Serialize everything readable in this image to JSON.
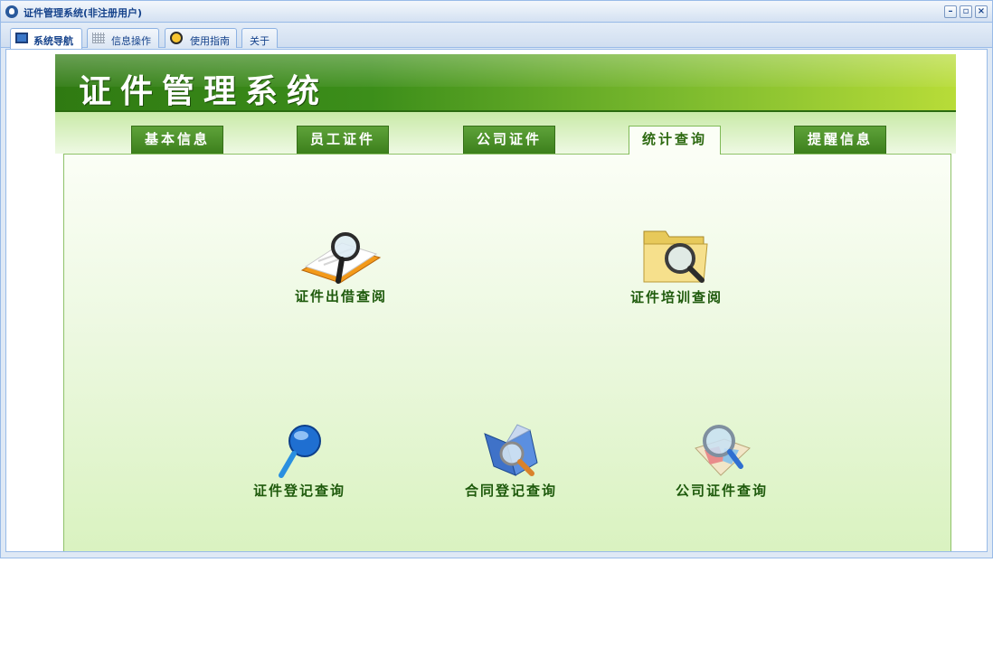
{
  "window": {
    "title": "证件管理系统(非注册用户)"
  },
  "app_tabs": [
    {
      "label": "系统导航",
      "icon": "monitor-icon",
      "active": true
    },
    {
      "label": "信息操作",
      "icon": "grid-icon",
      "active": false
    },
    {
      "label": "使用指南",
      "icon": "clock-icon",
      "active": false
    },
    {
      "label": "关于",
      "icon": "",
      "active": false
    }
  ],
  "banner": {
    "title": "证件管理系统"
  },
  "nav_tabs": [
    {
      "label": "基本信息",
      "active": false
    },
    {
      "label": "员工证件",
      "active": false
    },
    {
      "label": "公司证件",
      "active": false
    },
    {
      "label": "统计查询",
      "active": true
    },
    {
      "label": "提醒信息",
      "active": false
    }
  ],
  "functions": [
    {
      "label": "证件出借查阅",
      "icon": "book-magnifier-icon"
    },
    {
      "label": "证件培训查阅",
      "icon": "folder-magnifier-icon"
    },
    {
      "label": "证件登记查询",
      "icon": "magnifier-icon"
    },
    {
      "label": "合同登记查询",
      "icon": "document-magnifier-icon"
    },
    {
      "label": "公司证件查询",
      "icon": "map-magnifier-icon"
    }
  ],
  "colors": {
    "accent_green": "#3c7f1c",
    "label_green": "#1e5a0c",
    "title_blue": "#15428b"
  }
}
